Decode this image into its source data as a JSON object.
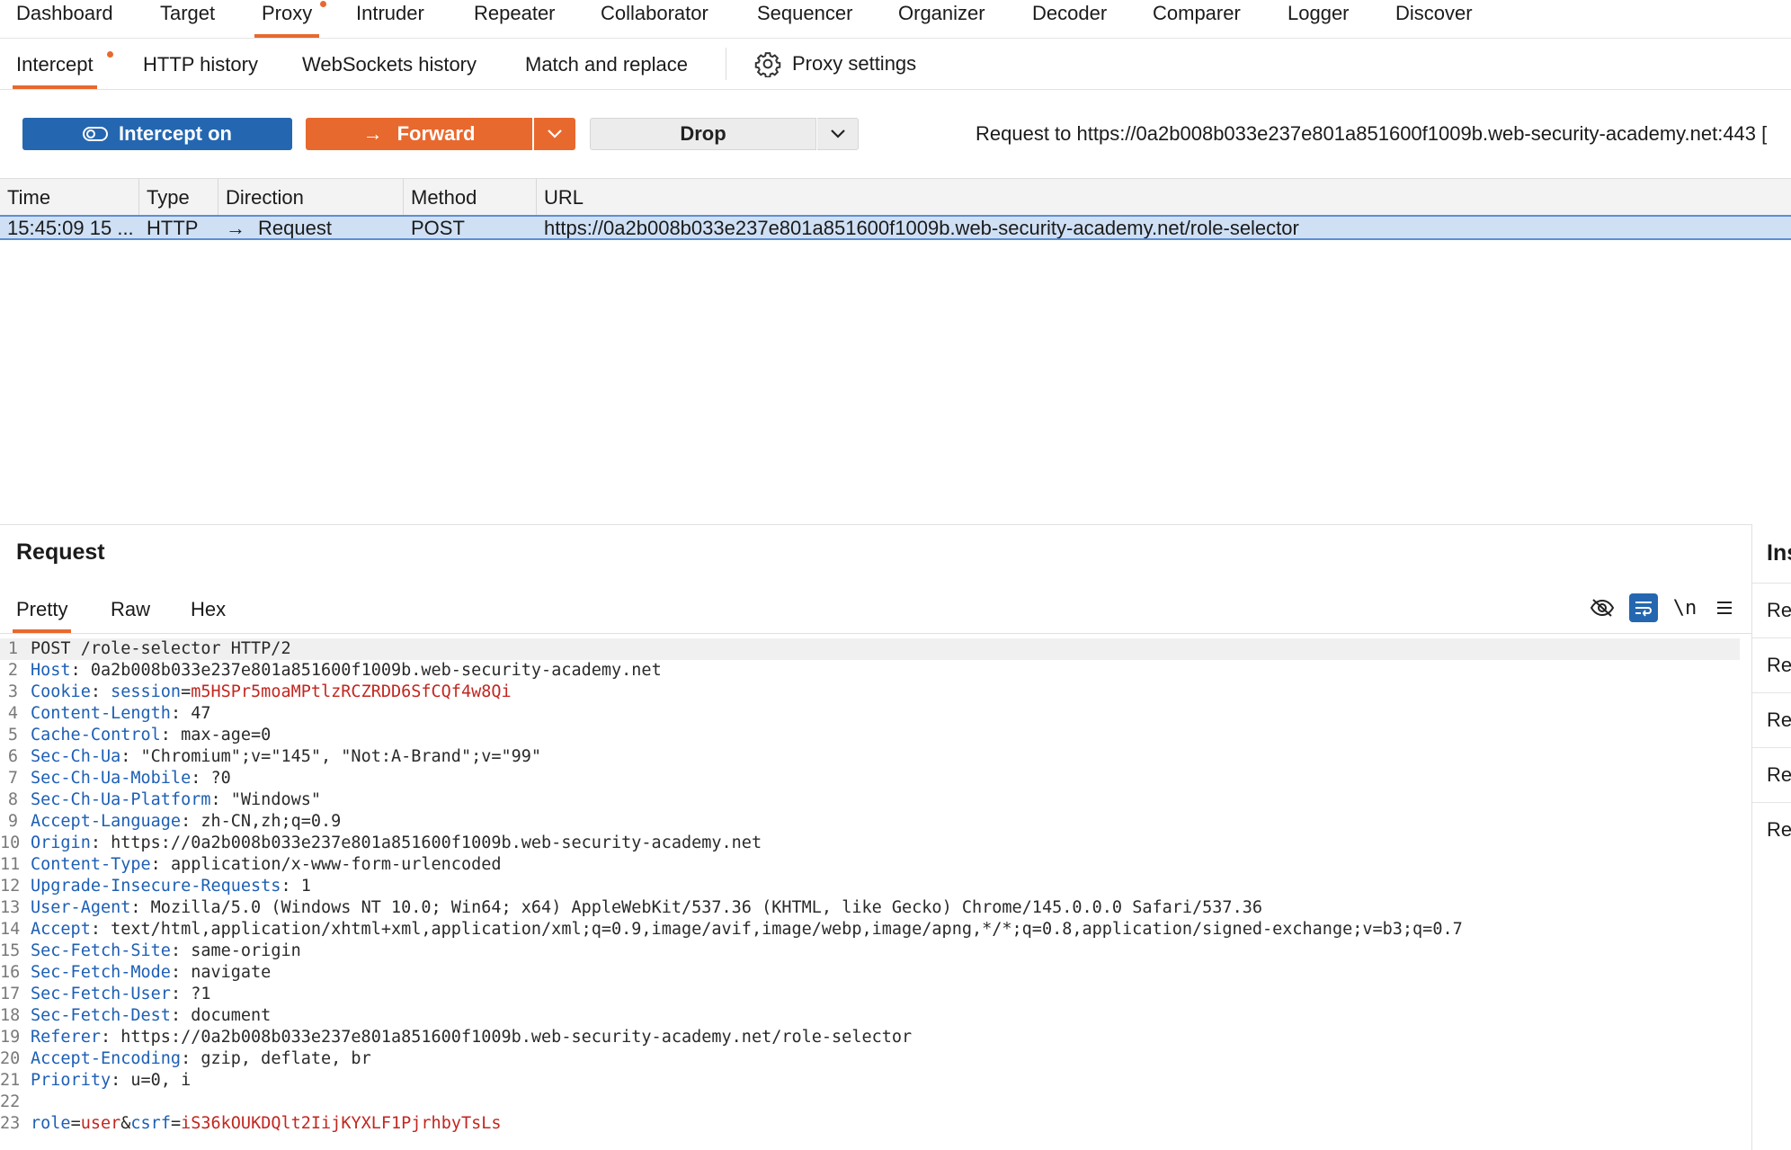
{
  "top_nav": {
    "tabs": [
      {
        "label": "Dashboard"
      },
      {
        "label": "Target"
      },
      {
        "label": "Proxy"
      },
      {
        "label": "Intruder"
      },
      {
        "label": "Repeater"
      },
      {
        "label": "Collaborator"
      },
      {
        "label": "Sequencer"
      },
      {
        "label": "Organizer"
      },
      {
        "label": "Decoder"
      },
      {
        "label": "Comparer"
      },
      {
        "label": "Logger"
      },
      {
        "label": "Discover"
      }
    ],
    "active": "Proxy"
  },
  "sub_nav": {
    "tabs": [
      {
        "label": "Intercept"
      },
      {
        "label": "HTTP history"
      },
      {
        "label": "WebSockets history"
      },
      {
        "label": "Match and replace"
      },
      {
        "label": "Proxy settings"
      }
    ],
    "active": "Intercept"
  },
  "toolbar": {
    "intercept_label": "Intercept on",
    "forward_label": "Forward",
    "drop_label": "Drop",
    "request_to": "Request to https://0a2b008b033e237e801a851600f1009b.web-security-academy.net:443  ["
  },
  "table": {
    "columns": [
      "Time",
      "Type",
      "Direction",
      "Method",
      "URL"
    ],
    "rows": [
      {
        "time": "15:45:09 15 ...",
        "type": "HTTP",
        "direction": "Request",
        "method": "POST",
        "url": "https://0a2b008b033e237e801a851600f1009b.web-security-academy.net/role-selector"
      }
    ]
  },
  "request_panel": {
    "title": "Request",
    "tabs": [
      "Pretty",
      "Raw",
      "Hex"
    ],
    "active_tab": "Pretty",
    "newline_label": "\\n",
    "lines": [
      {
        "n": "1",
        "key": "",
        "sep": "",
        "value": "POST /role-selector HTTP/2"
      },
      {
        "n": "2",
        "key": "Host",
        "sep": ": ",
        "value": "0a2b008b033e237e801a851600f1009b.web-security-academy.net"
      },
      {
        "n": "3",
        "key": "Cookie",
        "sep": ": ",
        "value": "",
        "cookie_name": "session",
        "cookie_value": "m5HSPr5moaMPtlzRCZRDD6SfCQf4w8Qi"
      },
      {
        "n": "4",
        "key": "Content-Length",
        "sep": ": ",
        "value": "47"
      },
      {
        "n": "5",
        "key": "Cache-Control",
        "sep": ": ",
        "value": "max-age=0"
      },
      {
        "n": "6",
        "key": "Sec-Ch-Ua",
        "sep": ": ",
        "value": "\"Chromium\";v=\"145\", \"Not:A-Brand\";v=\"99\""
      },
      {
        "n": "7",
        "key": "Sec-Ch-Ua-Mobile",
        "sep": ": ",
        "value": "?0"
      },
      {
        "n": "8",
        "key": "Sec-Ch-Ua-Platform",
        "sep": ": ",
        "value": "\"Windows\""
      },
      {
        "n": "9",
        "key": "Accept-Language",
        "sep": ": ",
        "value": "zh-CN,zh;q=0.9"
      },
      {
        "n": "10",
        "key": "Origin",
        "sep": ": ",
        "value": "https://0a2b008b033e237e801a851600f1009b.web-security-academy.net"
      },
      {
        "n": "11",
        "key": "Content-Type",
        "sep": ": ",
        "value": "application/x-www-form-urlencoded"
      },
      {
        "n": "12",
        "key": "Upgrade-Insecure-Requests",
        "sep": ": ",
        "value": "1"
      },
      {
        "n": "13",
        "key": "User-Agent",
        "sep": ": ",
        "value": "Mozilla/5.0 (Windows NT 10.0; Win64; x64) AppleWebKit/537.36 (KHTML, like Gecko) Chrome/145.0.0.0 Safari/537.36"
      },
      {
        "n": "14",
        "key": "Accept",
        "sep": ": ",
        "value": "text/html,application/xhtml+xml,application/xml;q=0.9,image/avif,image/webp,image/apng,*/*;q=0.8,application/signed-exchange;v=b3;q=0.7"
      },
      {
        "n": "15",
        "key": "Sec-Fetch-Site",
        "sep": ": ",
        "value": "same-origin"
      },
      {
        "n": "16",
        "key": "Sec-Fetch-Mode",
        "sep": ": ",
        "value": "navigate"
      },
      {
        "n": "17",
        "key": "Sec-Fetch-User",
        "sep": ": ",
        "value": "?1"
      },
      {
        "n": "18",
        "key": "Sec-Fetch-Dest",
        "sep": ": ",
        "value": "document"
      },
      {
        "n": "19",
        "key": "Referer",
        "sep": ": ",
        "value": "https://0a2b008b033e237e801a851600f1009b.web-security-academy.net/role-selector"
      },
      {
        "n": "20",
        "key": "Accept-Encoding",
        "sep": ": ",
        "value": "gzip, deflate, br"
      },
      {
        "n": "21",
        "key": "Priority",
        "sep": ": ",
        "value": "u=0, i"
      },
      {
        "n": "22",
        "key": "",
        "sep": "",
        "value": ""
      },
      {
        "n": "23",
        "key": "",
        "sep": "",
        "value": "",
        "body": [
          {
            "k": "role",
            "v": "user"
          },
          {
            "k": "csrf",
            "v": "iS36kOUKDQlt2IijKYXLF1PjrhbyTsLs"
          }
        ]
      }
    ]
  },
  "inspector": {
    "title": "Ins",
    "items": [
      "Re",
      "Re",
      "Re",
      "Re",
      "Re"
    ]
  },
  "colors": {
    "accent": "#e8692e",
    "primary_blue": "#2467b0",
    "selected_row": "#cfe0f5",
    "header_key": "#1d5fb5",
    "cookie_value": "#c2261f"
  }
}
